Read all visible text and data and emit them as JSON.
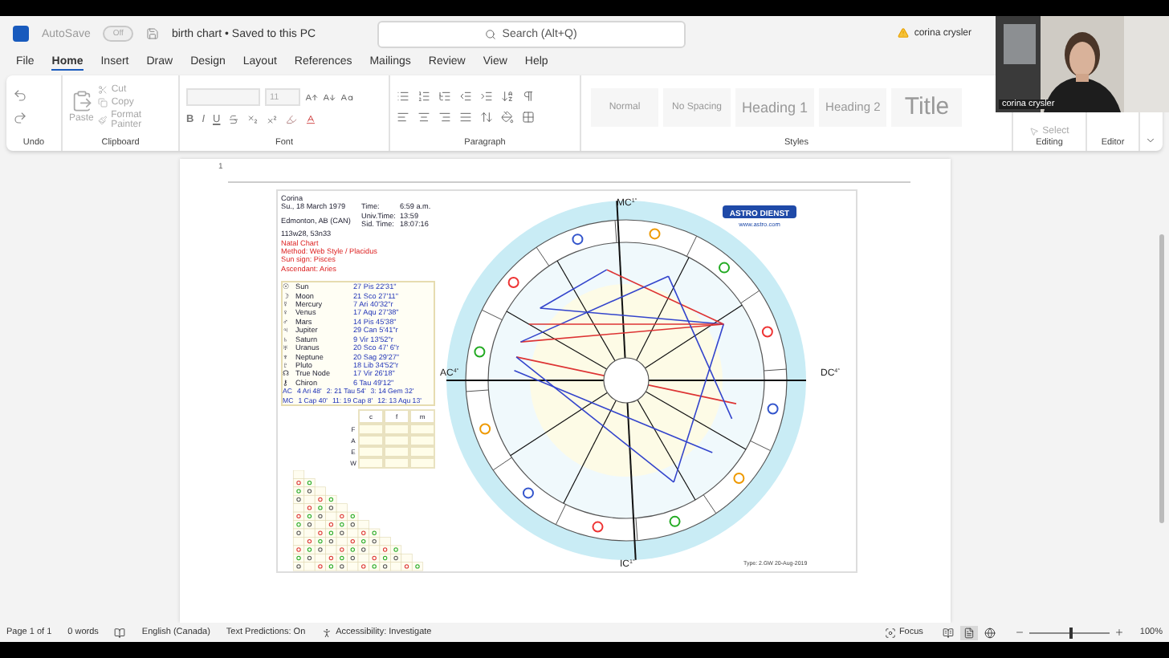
{
  "title_bar": {
    "autosave_label": "AutoSave",
    "autosave_toggle": {
      "label": "Off",
      "on": false
    },
    "document_title": "birth chart • Saved to this PC",
    "search": {
      "placeholder": "Search (Alt+Q)"
    },
    "account_name": "corina crysler"
  },
  "menu_tabs": [
    {
      "label": "File",
      "selected": false
    },
    {
      "label": "Home",
      "selected": true
    },
    {
      "label": "Insert",
      "selected": false
    },
    {
      "label": "Draw",
      "selected": false
    },
    {
      "label": "Design",
      "selected": false
    },
    {
      "label": "Layout",
      "selected": false
    },
    {
      "label": "References",
      "selected": false
    },
    {
      "label": "Mailings",
      "selected": false
    },
    {
      "label": "Review",
      "selected": false
    },
    {
      "label": "View",
      "selected": false
    },
    {
      "label": "Help",
      "selected": false
    }
  ],
  "ribbon": {
    "undo": {
      "label": "Undo"
    },
    "clipboard": {
      "paste": "Paste",
      "cut": "Cut",
      "copy": "Copy",
      "format_painter": "Format Painter",
      "label": "Clipboard"
    },
    "font": {
      "size_value": "11",
      "format_buttons": [
        "B",
        "I",
        "U"
      ],
      "label": "Font"
    },
    "paragraph": {
      "label": "Paragraph"
    },
    "styles": {
      "items": [
        {
          "label": "Normal",
          "kind": "body"
        },
        {
          "label": "No Spacing",
          "kind": "body"
        },
        {
          "label": "Heading 1",
          "kind": "heading"
        },
        {
          "label": "Heading 2",
          "kind": "subheading"
        },
        {
          "label": "Title",
          "kind": "title"
        }
      ],
      "label": "Styles"
    },
    "editing": {
      "select": "Select",
      "label": "Editing"
    },
    "editor": {
      "label": "Editor"
    }
  },
  "video_call": {
    "participant_name": "corina crysler"
  },
  "document": {
    "page_marker": "1",
    "chart": {
      "name": "Corina",
      "date": "Su., 18 March 1979",
      "place": "Edmonton, AB (CAN)",
      "coordinates": "113w28, 53n33",
      "times": [
        {
          "label": "Time:",
          "value": "6:59 a.m."
        },
        {
          "label": "Univ.Time:",
          "value": "13:59"
        },
        {
          "label": "Sid. Time:",
          "value": "18:07:16"
        }
      ],
      "notes": [
        "Natal Chart",
        "Method: Web Style / Placidus",
        "Sun sign: Pisces",
        "Ascendant: Aries"
      ],
      "planets": [
        {
          "glyph": "☉",
          "name": "Sun",
          "position": "27 Pis 22'31\""
        },
        {
          "glyph": "☽",
          "name": "Moon",
          "position": "21 Sco 27'11\""
        },
        {
          "glyph": "☿",
          "name": "Mercury",
          "position": "7 Ari 40'32\"r"
        },
        {
          "glyph": "♀",
          "name": "Venus",
          "position": "17 Aqu 27'38\""
        },
        {
          "glyph": "♂",
          "name": "Mars",
          "position": "14 Pis 45'38\""
        },
        {
          "glyph": "♃",
          "name": "Jupiter",
          "position": "29 Can 5'41\"r"
        },
        {
          "glyph": "♄",
          "name": "Saturn",
          "position": "9 Vir 13'52\"r"
        },
        {
          "glyph": "♅",
          "name": "Uranus",
          "position": "20 Sco 47' 6\"r"
        },
        {
          "glyph": "♆",
          "name": "Neptune",
          "position": "20 Sag 29'27\""
        },
        {
          "glyph": "♇",
          "name": "Pluto",
          "position": "18 Lib 34'52\"r"
        },
        {
          "glyph": "☊",
          "name": "True Node",
          "position": "17 Vir 26'18\""
        },
        {
          "glyph": "⚷",
          "name": "Chiron",
          "position": "6 Tau 49'12\""
        }
      ],
      "houses": [
        {
          "axis": "AC",
          "value": "4 Ari 48'",
          "cusps": [
            "2: 21 Tau 54'",
            "3: 14 Gem 32'"
          ]
        },
        {
          "axis": "MC",
          "value": "1 Cap 40'",
          "cusps": [
            "11: 19 Cap 8'",
            "12: 13 Aqu 13'"
          ]
        }
      ],
      "element_table": {
        "columns": [
          "c",
          "f",
          "m"
        ],
        "rows": [
          "F",
          "A",
          "E",
          "W"
        ]
      },
      "axes": [
        {
          "label": "MC",
          "degree": "1°"
        },
        {
          "label": "AC",
          "degree": "4°"
        },
        {
          "label": "DC",
          "degree": "4°"
        },
        {
          "label": "IC",
          "degree": "1°"
        }
      ],
      "logo": {
        "name": "ASTRO DIENST",
        "url": "www.astro.com"
      },
      "footer": "Type: 2.GW  20-Aug-2019"
    }
  },
  "status_bar": {
    "page_count": "Page 1 of 1",
    "word_count": "0 words",
    "language": "English (Canada)",
    "text_predictions": "Text Predictions: On",
    "accessibility": "Accessibility: Investigate",
    "focus": "Focus",
    "views": [
      {
        "kind": "read",
        "selected": false
      },
      {
        "kind": "print",
        "selected": true
      },
      {
        "kind": "web",
        "selected": false
      }
    ],
    "zoom": {
      "value": "100%",
      "level": 0.5
    }
  }
}
